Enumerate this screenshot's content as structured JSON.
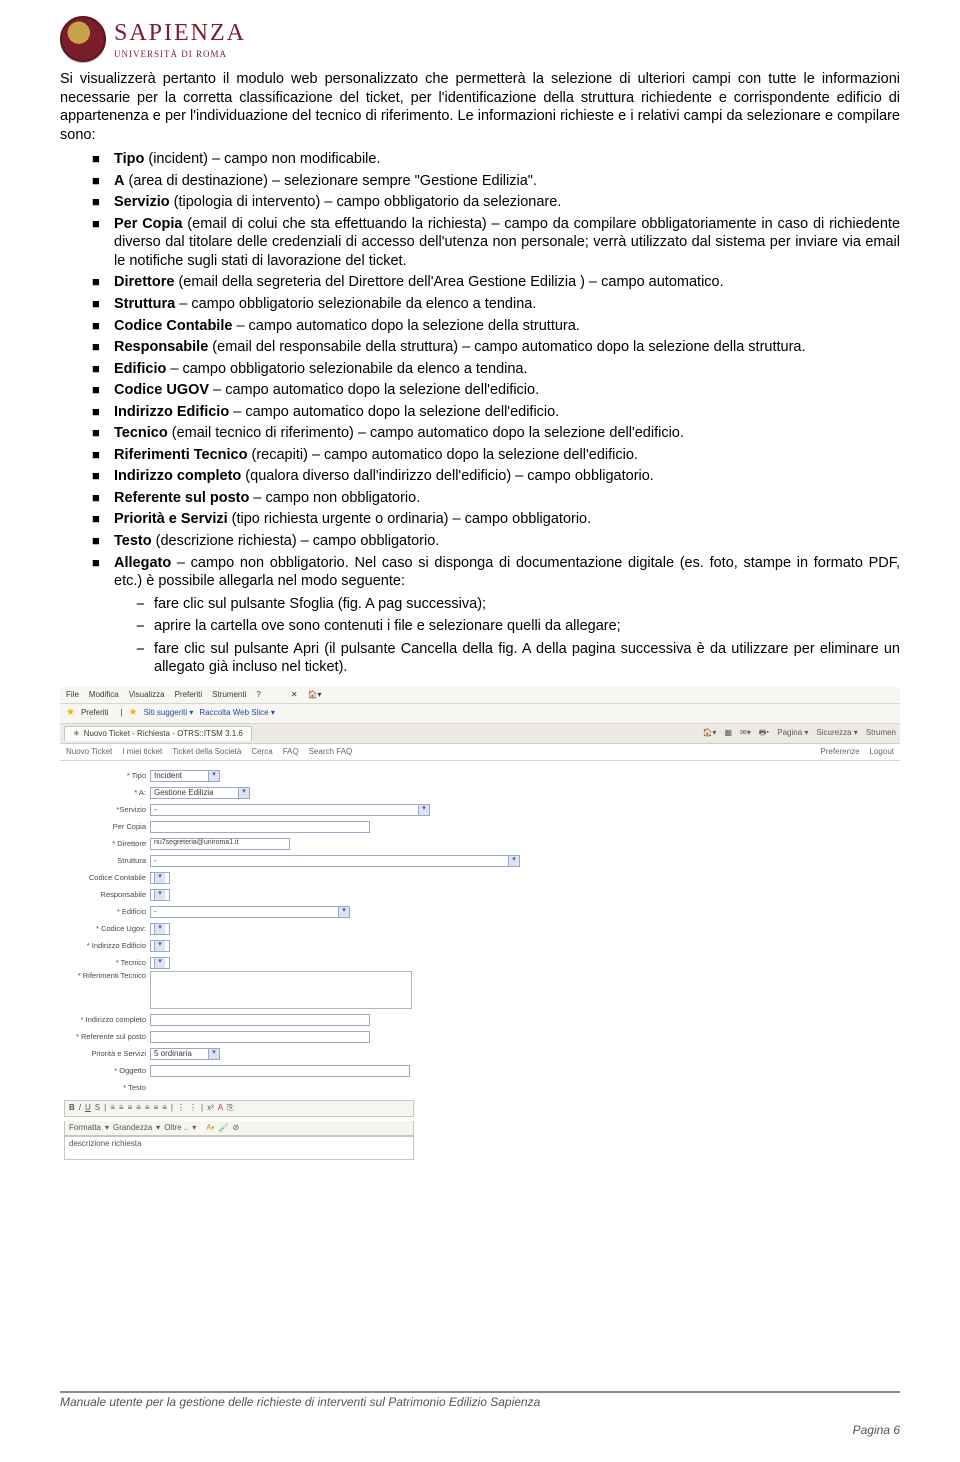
{
  "header": {
    "brand": "SAPIENZA",
    "sub": "UNIVERSITÀ DI ROMA"
  },
  "intro": "Si visualizzerà pertanto il modulo web personalizzato che permetterà la selezione di ulteriori campi con tutte le informazioni necessarie per la corretta classificazione del ticket, per l'identificazione della struttura richiedente e corrispondente edificio di appartenenza e per l'individuazione del tecnico di riferimento. Le informazioni richieste e i relativi campi da selezionare e compilare sono:",
  "bullets": [
    {
      "b": "Tipo",
      "t": " (incident) – campo non modificabile."
    },
    {
      "b": "A",
      "t": " (area di destinazione) – selezionare sempre \"Gestione Edilizia\"."
    },
    {
      "b": "Servizio",
      "t": " (tipologia di intervento) – campo obbligatorio da selezionare."
    },
    {
      "b": "Per Copia",
      "t": " (email di colui che sta effettuando la richiesta) – campo da compilare obbligatoriamente in caso di richiedente diverso dal titolare delle credenziali di accesso dell'utenza non personale; verrà utilizzato dal sistema per inviare via email le notifiche sugli stati di lavorazione del ticket."
    },
    {
      "b": "Direttore",
      "t": " (email della segreteria del Direttore dell'Area Gestione Edilizia ) – campo automatico."
    },
    {
      "b": "Struttura",
      "t": " – campo obbligatorio selezionabile da elenco a tendina."
    },
    {
      "b": "Codice Contabile",
      "t": " – campo automatico dopo la selezione della struttura."
    },
    {
      "b": "Responsabile",
      "t": " (email del responsabile della struttura) – campo automatico dopo la selezione della struttura."
    },
    {
      "b": "Edificio",
      "t": " – campo obbligatorio selezionabile da elenco a tendina."
    },
    {
      "b": "Codice UGOV",
      "t": " – campo automatico dopo la selezione dell'edificio."
    },
    {
      "b": "Indirizzo Edificio",
      "t": " – campo automatico dopo la selezione dell'edificio."
    },
    {
      "b": "Tecnico",
      "t": " (email tecnico di riferimento) – campo automatico dopo la selezione dell'edificio."
    },
    {
      "b": "Riferimenti Tecnico",
      "t": " (recapiti) – campo automatico dopo la selezione dell'edificio."
    },
    {
      "b": "Indirizzo completo",
      "t": " (qualora diverso dall'indirizzo dell'edificio) – campo obbligatorio."
    },
    {
      "b": "Referente sul posto",
      "t": " – campo non obbligatorio."
    },
    {
      "b": "Priorità e Servizi",
      "t": " (tipo richiesta urgente o ordinaria) – campo obbligatorio."
    },
    {
      "b": "Testo",
      "t": " (descrizione richiesta) – campo obbligatorio."
    },
    {
      "b": "Allegato",
      "t": " – campo non obbligatorio. Nel caso si disponga di documentazione digitale (es. foto, stampe in formato PDF, etc.) è possibile allegarla nel modo seguente:"
    }
  ],
  "sub": [
    "fare clic sul pulsante Sfoglia (fig. A pag successiva);",
    "aprire la cartella ove sono contenuti i file e selezionare quelli da allegare;",
    "fare clic sul pulsante Apri (il pulsante Cancella della fig. A della pagina successiva è da utilizzare per eliminare un allegato già incluso nel ticket)."
  ],
  "shot": {
    "menubar": [
      "File",
      "Modifica",
      "Visualizza",
      "Preferiti",
      "Strumenti",
      "?"
    ],
    "favbar_label": "Preferiti",
    "favbar_items": [
      "Siti suggeriti ▾",
      "Raccolta Web Slice ▾"
    ],
    "tab_title": "Nuovo Ticket - Richiesta - OTRS::ITSM 3.1.6",
    "tool_right": [
      "Pagina ▾",
      "Sicurezza ▾",
      "Strumen"
    ],
    "otrs_left": [
      "Nuovo Ticket",
      "I miei ticket",
      "Ticket della Società",
      "Cerca",
      "FAQ",
      "Search FAQ"
    ],
    "otrs_right": [
      "Preferenze",
      "Logout"
    ],
    "fields": {
      "tipo_label": "* Tipo",
      "tipo_val": "Incident",
      "a_label": "* A:",
      "a_val": "Gestione Edilizia",
      "servizio_label": "*Servizio",
      "servizio_val": "-",
      "percopia_label": "Per Copia",
      "direttore_label": "* Direttore",
      "direttore_val": "riu7segreteria@uniroma1.it",
      "struttura_label": "Struttura",
      "struttura_val": "-",
      "codcont_label": "Codice Contabile",
      "responsabile_label": "Responsabile",
      "edificio_label": "* Edificio",
      "edificio_val": "-",
      "codugov_label": "* Codice Ugov:",
      "indedif_label": "* Indirizzo Edificio",
      "tecnico_label": "* Tecnico",
      "riftec_label": "* Riferimenti Tecnico",
      "indcomp_label": "* Indirizzo completo",
      "referente_label": "* Referente sul posto",
      "priorita_label": "Priorità e Servizi",
      "priorita_val": "5 ordinaria",
      "oggetto_label": "* Oggetto",
      "testo_label": "* Testo"
    },
    "rte1": [
      "B",
      "I",
      "U",
      "S",
      "|",
      "≡",
      "≡",
      "≡",
      "≡",
      "≡",
      "≡",
      "≡",
      "|",
      "⋮",
      "⋮",
      "|",
      "x²",
      "A",
      "⎘"
    ],
    "rte2_labels": [
      "Formatta",
      "Grandezza",
      "Oltre .."
    ],
    "rte_text": "descrizione richiesta"
  },
  "footer": {
    "line": "Manuale utente per la gestione delle richieste di interventi sul Patrimonio Edilizio Sapienza",
    "page": "Pagina 6"
  }
}
